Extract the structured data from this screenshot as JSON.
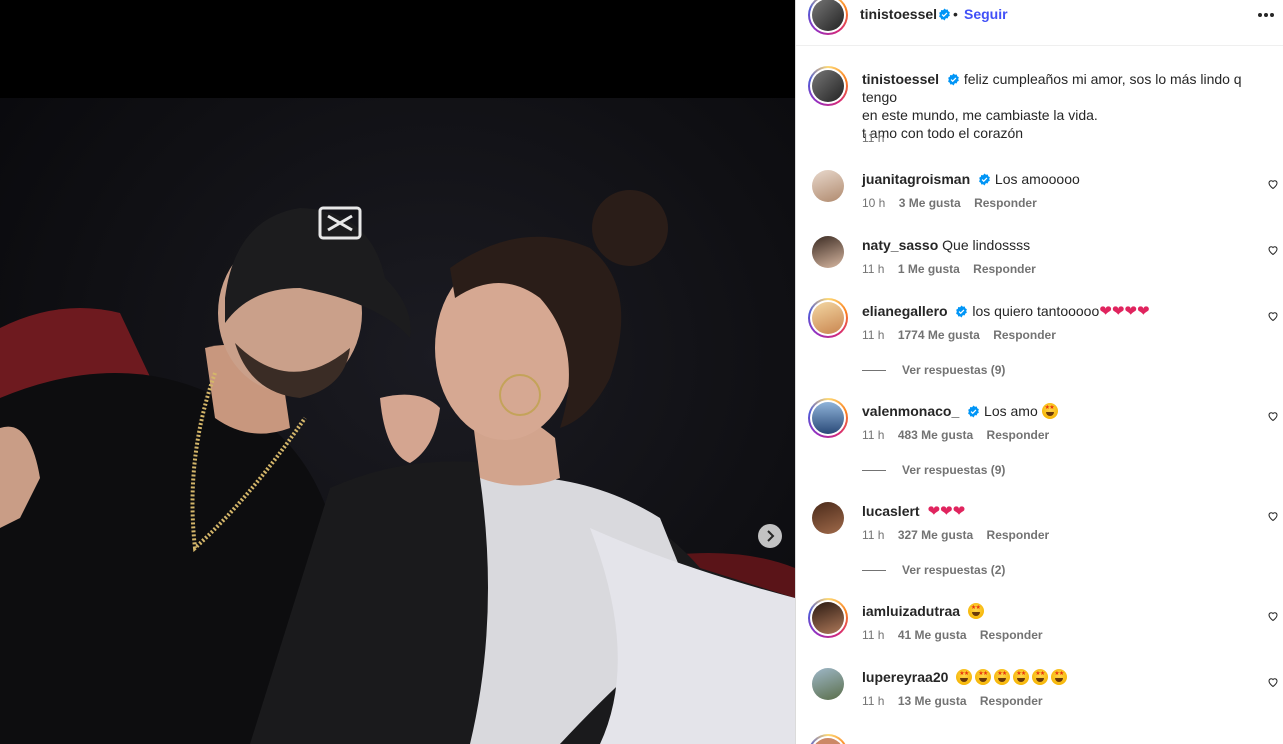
{
  "post": {
    "author": "tinistoessel",
    "follow_label": "Seguir",
    "separator": "•",
    "caption_line1": "feliz cumpleaños mi amor, sos lo más lindo q tengo",
    "caption_line2": "en este mundo, me cambiaste la vida.",
    "caption_line3": "t amo con todo el corazón",
    "time": "11 h"
  },
  "comments": [
    {
      "user": "juanitagroisman",
      "verified": true,
      "text": "Los amooooo",
      "time": "10 h",
      "likes": "3 Me gusta",
      "reply": "Responder"
    },
    {
      "user": "naty_sasso",
      "verified": false,
      "text": "Que lindossss",
      "time": "11 h",
      "likes": "1 Me gusta",
      "reply": "Responder"
    },
    {
      "user": "elianegallero",
      "verified": true,
      "text": "los quiero tantooooo",
      "emoji": "❤❤❤❤",
      "time": "11 h",
      "likes": "1774 Me gusta",
      "reply": "Responder",
      "replies": "Ver respuestas (9)"
    },
    {
      "user": "valenmonaco_",
      "verified": true,
      "text": "Los amo",
      "time": "11 h",
      "likes": "483 Me gusta",
      "reply": "Responder",
      "replies": "Ver respuestas (9)"
    },
    {
      "user": "lucaslert",
      "verified": false,
      "text": "",
      "emoji": "❤❤❤",
      "time": "11 h",
      "likes": "327 Me gusta",
      "reply": "Responder",
      "replies": "Ver respuestas (2)"
    },
    {
      "user": "iamluizadutraa",
      "verified": false,
      "text": "",
      "time": "11 h",
      "likes": "41 Me gusta",
      "reply": "Responder"
    },
    {
      "user": "lupereyraa20",
      "verified": false,
      "text": "",
      "time": "11 h",
      "likes": "13 Me gusta",
      "reply": "Responder"
    }
  ],
  "icons": {
    "verified": "verified-badge-icon",
    "more": "more-options-icon",
    "like": "heart-outline-icon",
    "next": "chevron-right-icon"
  },
  "colors": {
    "link_blue": "#0095f6",
    "follow_blue": "#4150f7",
    "verified_blue": "#0095f6",
    "heart_red": "#e0245e"
  }
}
